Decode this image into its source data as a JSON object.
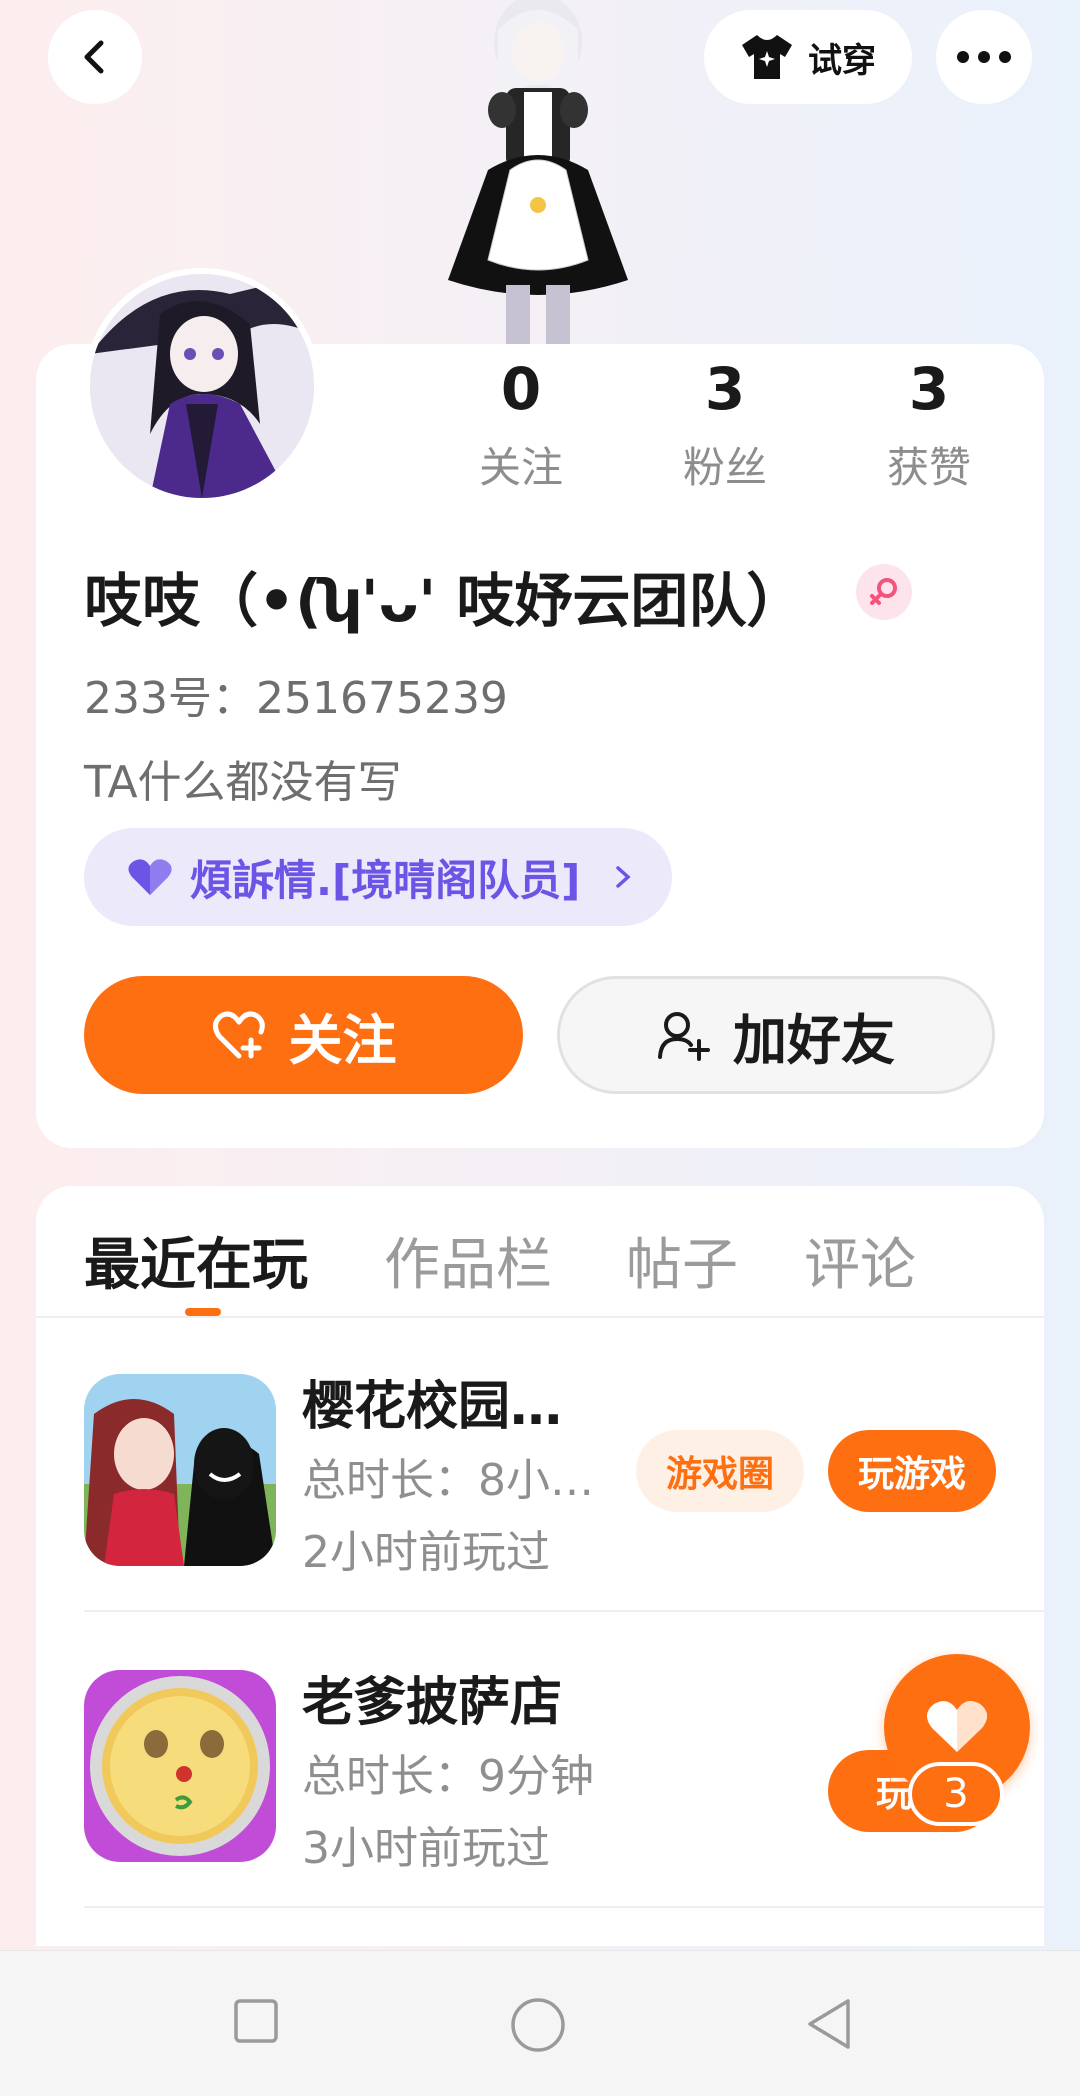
{
  "header": {
    "tryon_label": "试穿"
  },
  "stats": [
    {
      "value": "0",
      "label": "关注"
    },
    {
      "value": "3",
      "label": "粉丝"
    },
    {
      "value": "3",
      "label": "获赞"
    }
  ],
  "profile": {
    "name": "吱吱（•(ʮ'ᴗ' 吱妤云团队）",
    "uid": "233号：251675239",
    "bio": "TA什么都没有写",
    "team_tag": "煩訴情.[境晴阁队员]",
    "follow_label": "关注",
    "add_friend_label": "加好友"
  },
  "tabs": [
    {
      "label": "最近在玩",
      "active": true
    },
    {
      "label": "作品栏",
      "active": false
    },
    {
      "label": "帖子",
      "active": false
    },
    {
      "label": "评论",
      "active": false
    }
  ],
  "games": [
    {
      "title": "樱花校园…",
      "duration": "总时长：8小…",
      "last_played": "2小时前玩过",
      "circle_label": "游戏圈",
      "play_label": "玩游戏"
    },
    {
      "title": "老爹披萨店",
      "duration": "总时长：9分钟",
      "last_played": "3小时前玩过",
      "play_label": "玩游"
    }
  ],
  "like_fab": {
    "count": "3"
  },
  "colors": {
    "accent": "#fe6f12",
    "team_tag_bg": "#ece9fb",
    "team_tag_text": "#6c54e6"
  }
}
